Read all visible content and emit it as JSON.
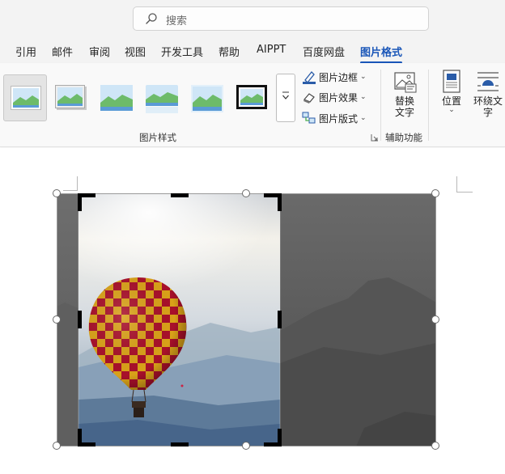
{
  "search": {
    "placeholder": "搜索"
  },
  "tabs": [
    {
      "label": "引用"
    },
    {
      "label": "邮件"
    },
    {
      "label": "审阅"
    },
    {
      "label": "视图"
    },
    {
      "label": "开发工具"
    },
    {
      "label": "帮助"
    },
    {
      "label": "AIPPT"
    },
    {
      "label": "百度网盘"
    },
    {
      "label": "图片格式",
      "active": true
    }
  ],
  "ribbon": {
    "picture_styles": {
      "group_label": "图片样式",
      "styles": [
        "simple-frame-white",
        "soft-shadow-frame",
        "soft-edge-rectangle",
        "reflected-rounded",
        "soft-glow",
        "thick-black-frame"
      ],
      "selected_index": 0
    },
    "picture_commands": {
      "border_label": "图片边框",
      "effects_label": "图片效果",
      "layout_label": "图片版式"
    },
    "accessibility": {
      "group_label": "辅助功能",
      "alt_text_line1": "替换",
      "alt_text_line2": "文字"
    },
    "arrange": {
      "position_label": "位置",
      "wrap_line1": "环绕文",
      "wrap_line2": "字"
    }
  },
  "document": {
    "image_subject": "hot-air-balloon-over-mountains",
    "crop_mode": true
  },
  "colors": {
    "accent": "#1a56b8",
    "ribbon_bg": "#f9f9f9",
    "topbar_bg": "#f3f3f3"
  }
}
